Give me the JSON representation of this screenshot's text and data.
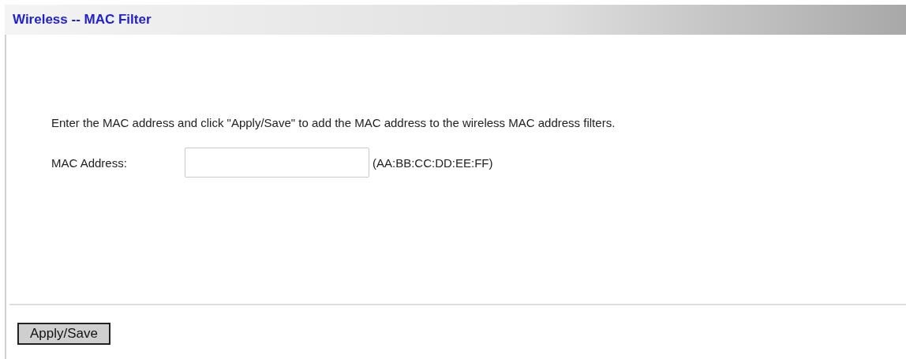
{
  "header": {
    "title": "Wireless -- MAC Filter"
  },
  "instructions": "Enter the MAC address and click \"Apply/Save\" to add the MAC address to the wireless MAC address filters.",
  "mac_address": {
    "label": "MAC Address:",
    "hint": "(AA:BB:CC:DD:EE:FF)"
  },
  "buttons": [
    "Apply/Save"
  ]
}
